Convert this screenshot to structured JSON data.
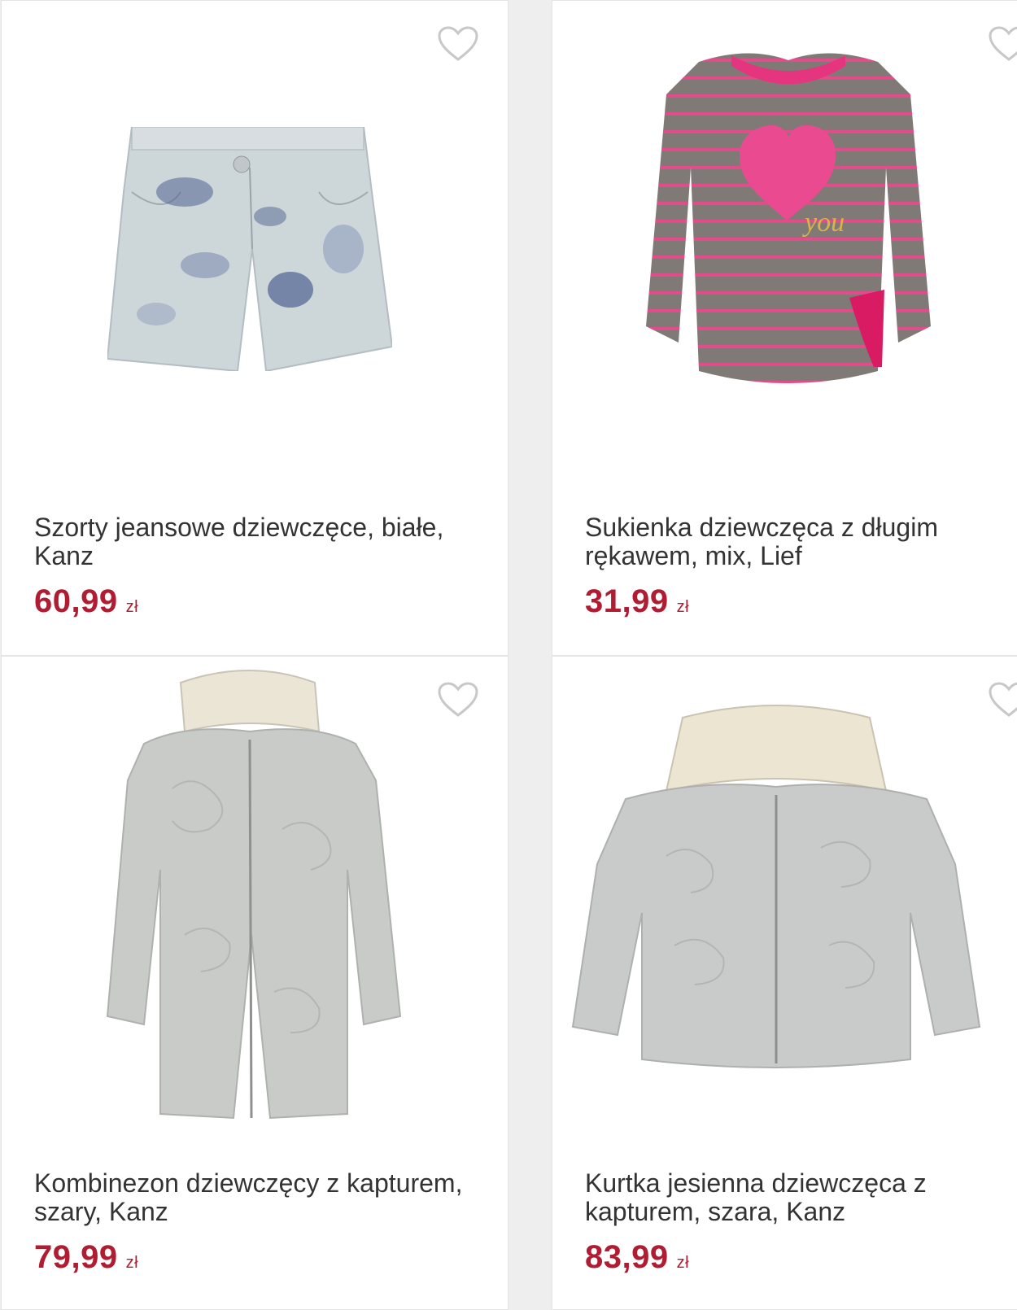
{
  "products": [
    {
      "title": "Szorty jeansowe dziewczęce, białe, Kanz",
      "price": "60,99",
      "currency": "zł",
      "image_icon": "denim-shorts-image"
    },
    {
      "title": "Sukienka dziewczęca z długim rękawem, mix, Lief",
      "price": "31,99",
      "currency": "zł",
      "image_icon": "striped-dress-image"
    },
    {
      "title": "Kombinezon dziewczęcy z kapturem, szary, Kanz",
      "price": "79,99",
      "currency": "zł",
      "image_icon": "hooded-jumpsuit-image"
    },
    {
      "title": "Kurtka jesienna dziewczęca z kapturem, szara, Kanz",
      "price": "83,99",
      "currency": "zł",
      "image_icon": "hooded-jacket-image"
    }
  ],
  "favorite_icon": "heart-outline-icon",
  "colors": {
    "price": "#b01c31",
    "title": "#333333",
    "background": "#eeeeee",
    "card": "#ffffff"
  }
}
